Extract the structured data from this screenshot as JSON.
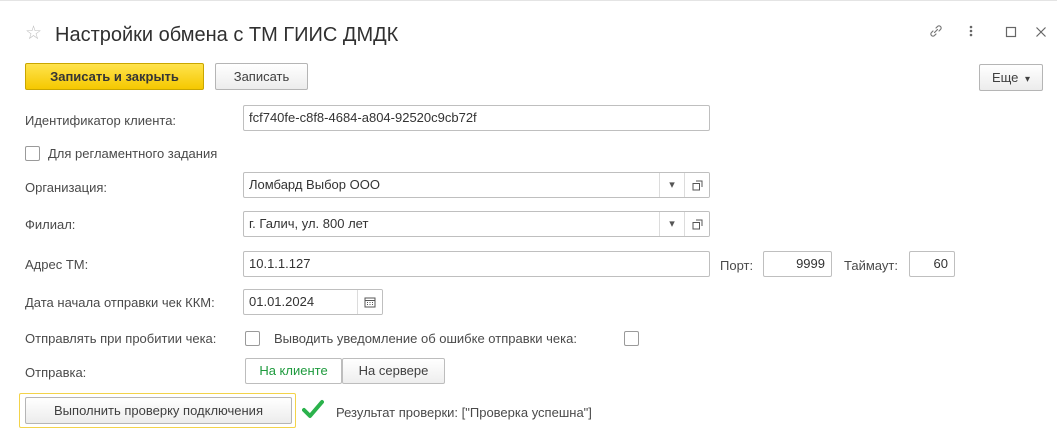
{
  "window": {
    "title": "Настройки обмена с ТМ ГИИС ДМДК",
    "favorite_icon": "star-outline-icon",
    "header_icons": [
      "link-icon",
      "more-vertical-icon",
      "maximize-icon",
      "close-icon"
    ]
  },
  "toolbar": {
    "save_close_label": "Записать и закрыть",
    "save_label": "Записать",
    "more_label": "Еще",
    "more_arrow": "▾"
  },
  "form": {
    "client_id_label": "Идентификатор клиента:",
    "client_id_value": "fcf740fe-c8f8-4684-a804-92520c9cb72f",
    "scheduled_label": "Для регламентного задания",
    "scheduled_checked": false,
    "org_label": "Организация:",
    "org_value": "Ломбард Выбор ООО",
    "branch_label": "Филиал:",
    "branch_value": "г. Галич, ул. 800 лет",
    "address_label": "Адрес ТМ:",
    "address_value": "10.1.1.127",
    "port_label": "Порт:",
    "port_value": "9999",
    "timeout_label": "Таймаут:",
    "timeout_value": "60",
    "start_date_label": "Дата начала отправки чек ККМ:",
    "start_date_value": "01.01.2024",
    "send_on_receipt_label": "Отправлять при пробитии чека:",
    "send_on_receipt_checked": false,
    "notify_error_label": "Выводить уведомление об ошибке отправки чека:",
    "notify_error_checked": false,
    "send_mode_label": "Отправка:",
    "send_mode_options": [
      "На клиенте",
      "На сервере"
    ],
    "send_mode_selected": "На клиенте",
    "check_button_label": "Выполнить проверку подключения",
    "result_label": "Результат проверки:",
    "result_value": "[\"Проверка успешна\"]"
  },
  "colors": {
    "primary_button": "#f5c800",
    "active_toggle_text": "#1d9a3d",
    "success_check": "#2bb24c"
  }
}
